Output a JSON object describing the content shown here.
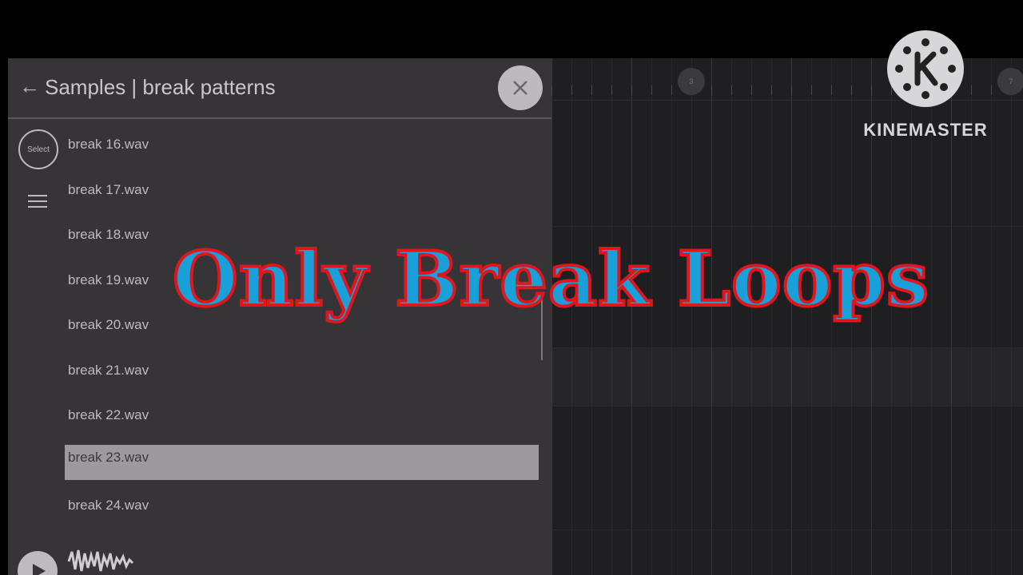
{
  "browser": {
    "back_label": "←",
    "title": "Samples | break patterns",
    "select_label": "Select",
    "files": [
      "break 16.wav",
      "break 17.wav",
      "break 18.wav",
      "break 19.wav",
      "break 20.wav",
      "break 21.wav",
      "break 22.wav",
      "break 23.wav",
      "break 24.wav"
    ],
    "selected_file": "break 23.wav"
  },
  "overlay": {
    "heading": "Only Break Loops"
  },
  "watermark": {
    "brand": "KINEMASTER"
  },
  "timeline": {
    "markers": [
      "3",
      "7"
    ]
  },
  "colors": {
    "panel_bg": "#363437",
    "selected_row": "#9c9a9d",
    "heading_fill": "#1aa0d8",
    "heading_stroke": "#e0161e"
  },
  "icons": [
    "back-arrow-icon",
    "close-icon",
    "menu-icon",
    "play-icon",
    "waveform-icon",
    "kinemaster-logo-icon"
  ]
}
